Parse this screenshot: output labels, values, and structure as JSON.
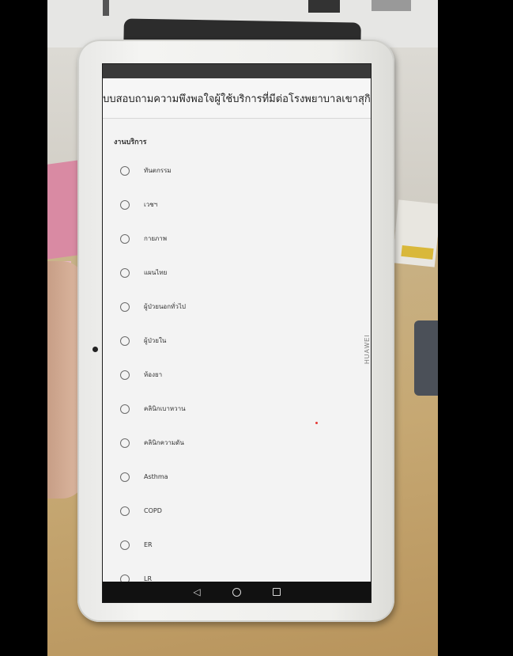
{
  "survey": {
    "title": "แบบสอบถามความพึงพอใจผู้ใช้บริการที่มีต่อโรงพยาบาลเขาสุกิม",
    "section_label": "งานบริการ",
    "options": [
      {
        "label": "ทันตกรรม"
      },
      {
        "label": "เวชฯ"
      },
      {
        "label": "กายภาพ"
      },
      {
        "label": "แผนไทย"
      },
      {
        "label": "ผู้ป่วยนอกทั่วไป"
      },
      {
        "label": "ผู้ป่วยใน"
      },
      {
        "label": "ห้องยา"
      },
      {
        "label": "คลินิกเบาหวาน"
      },
      {
        "label": "คลินิกความดัน"
      },
      {
        "label": "Asthma"
      },
      {
        "label": "COPD"
      },
      {
        "label": "ER"
      },
      {
        "label": "LR"
      }
    ]
  },
  "device": {
    "brand": "HUAWEI"
  },
  "nav": {
    "back_icon": "back-triangle-icon",
    "home_icon": "home-circle-icon",
    "recents_icon": "recents-square-icon"
  }
}
